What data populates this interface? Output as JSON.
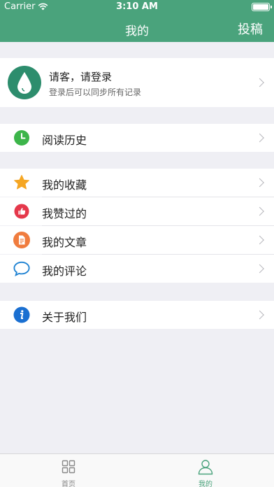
{
  "status_bar": {
    "carrier": "Carrier",
    "time": "3:10 AM"
  },
  "nav": {
    "title": "我的",
    "right_label": "投稿"
  },
  "profile": {
    "name": "请客，请登录",
    "subtitle": "登录后可以同步所有记录"
  },
  "groups": [
    {
      "items": [
        {
          "label": "阅读历史",
          "icon": "clock-icon"
        }
      ]
    },
    {
      "items": [
        {
          "label": "我的收藏",
          "icon": "star-icon"
        },
        {
          "label": "我赞过的",
          "icon": "thumbs-up-icon"
        },
        {
          "label": "我的文章",
          "icon": "document-icon"
        },
        {
          "label": "我的评论",
          "icon": "speech-bubble-icon"
        }
      ]
    },
    {
      "items": [
        {
          "label": "关于我们",
          "icon": "info-icon"
        }
      ]
    }
  ],
  "tabbar": {
    "tabs": [
      {
        "label": "首页",
        "icon": "grid-icon",
        "active": false
      },
      {
        "label": "我的",
        "icon": "person-icon",
        "active": true
      }
    ]
  },
  "colors": {
    "accent": "#4aa37c",
    "avatar": "#2d8d6d",
    "clock": "#3cb54a",
    "star": "#f5a623",
    "like": "#e5384b",
    "doc": "#f07c3e",
    "comment": "#1e82d2",
    "info": "#1a6fd1"
  }
}
